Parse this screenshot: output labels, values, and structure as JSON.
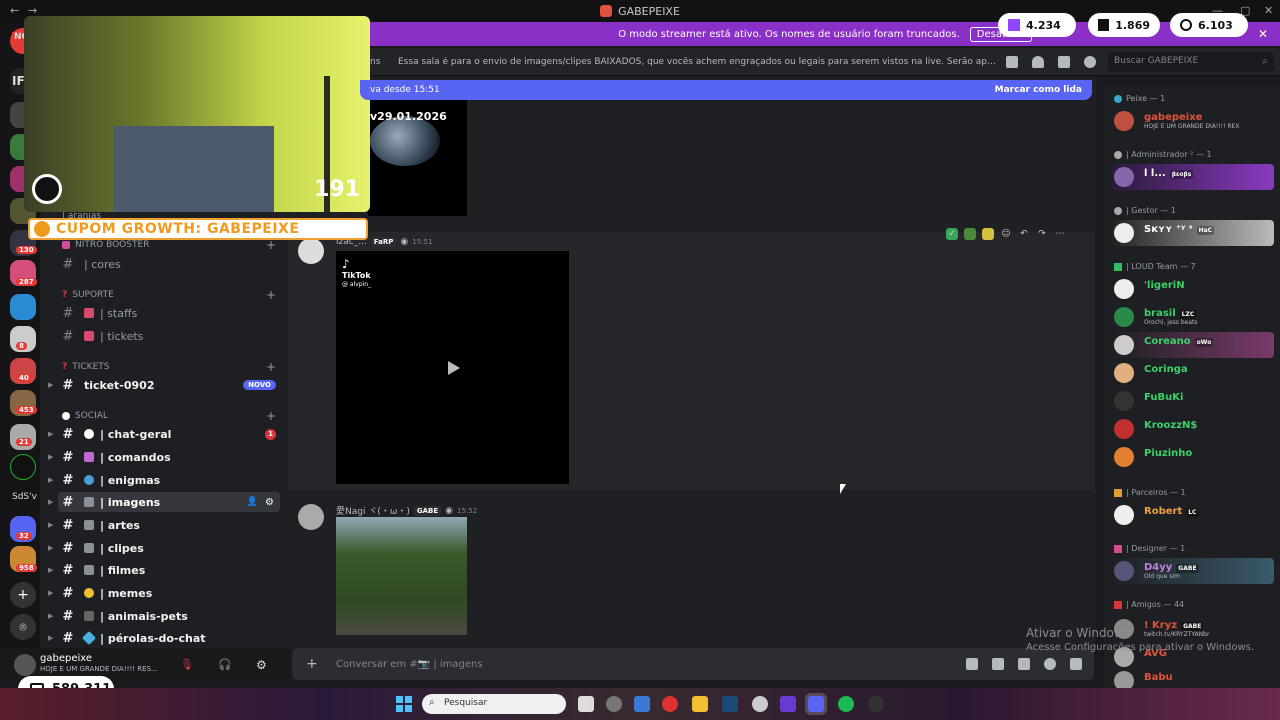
{
  "window": {
    "title": "GABEPEIXE"
  },
  "streamer_banner": {
    "text": "O modo streamer está ativo. Os nomes de usuário foram truncados.",
    "button": "Desativar"
  },
  "stats": [
    {
      "icon": "twitch-icon",
      "value": "4.234"
    },
    {
      "icon": "kick-icon",
      "value": "1.869"
    },
    {
      "icon": "globe-icon",
      "value": "6.103"
    }
  ],
  "channel_header": {
    "name_fragment": "ns",
    "topic": "Essa sala é para o envio de imagens/clipes BAIXADOS, que vocês achem engraçados ou legais para serem vistos na live. Serão apagados prints de o..."
  },
  "search": {
    "placeholder": "Buscar GABEPEIXE"
  },
  "new_messages_bar": {
    "left": "va desde 15:51",
    "right": "Marcar como lida"
  },
  "webcam": {
    "counter": "191"
  },
  "promo": {
    "text": "CUPOM GROWTH: GABEPEIXE"
  },
  "rail": {
    "labels": [
      "NO",
      "IF",
      "SdS'v"
    ],
    "badges": [
      "130",
      "287",
      "8",
      "40",
      "453",
      "21",
      "32",
      "958"
    ]
  },
  "channel_list": {
    "partial_top": "| aranias",
    "categories": {
      "nitro": "NITRO BOOSTER",
      "suporte": "SUPORTE",
      "tickets": "TICKETS",
      "social": "SOCIAL"
    },
    "channels": {
      "cores": "| cores",
      "staffs": "| staffs",
      "tickets": "| tickets",
      "ticket_0902": "ticket-0902",
      "chat_geral": "| chat-geral",
      "comandos": "| comandos",
      "enigmas": "| enigmas",
      "imagens": "| imagens",
      "artes": "| artes",
      "clipes": "| clipes",
      "filmes": "| filmes",
      "memes": "| memes",
      "animais_pets": "| animais-pets",
      "perolas": "| pérolas-do-chat"
    },
    "badge_new": "NOVO",
    "badge_unread": "1"
  },
  "messages": {
    "m1": {
      "user": "lzac_...",
      "tag": "FaRP",
      "time": "15:51",
      "attachment_logo": "TikTok",
      "attachment_handle": "@ alvpin_"
    },
    "m2": {
      "user": "愛Nagi ヾ(・ω・)",
      "tag": "GABE",
      "time": "15:52"
    },
    "top_image_text": "v29.01.2026"
  },
  "composer": {
    "placeholder": "Conversar em #📷 | imagens"
  },
  "user_panel": {
    "name": "gabepeixe",
    "status": "HOJE E UM GRANDE DIA!!!! RES...",
    "coins": "589.311"
  },
  "members": {
    "roles": {
      "peixe": "Peixe — 1",
      "admin": "| Administrador ² — 1",
      "gestor": "| Gestor — 1",
      "loud": "| LOUD Team — 7",
      "parceiros": "| Parceiros — 1",
      "designer": "| Designer — 1",
      "amigos": "| Amigos — 44"
    },
    "list": {
      "gabepeixe": {
        "name": "gabepeixe",
        "sub": "HOJE E UM GRANDE DIA!!!! REX"
      },
      "admin1": {
        "name": "l l...",
        "tag": "βεοβs"
      },
      "skyy": {
        "name": "Sĸʏʏ ⁺ʸ ˢ",
        "tag": "HaC"
      },
      "ligerin": {
        "name": "'ligeriN"
      },
      "brasil": {
        "name": "brasil",
        "tag": "LZC",
        "sub": "Orochi, jess beats"
      },
      "coreano": {
        "name": "Coreano",
        "tag": "oWo"
      },
      "coringa": {
        "name": "Coringa"
      },
      "fubuki": {
        "name": "FuBuKi"
      },
      "kroozz": {
        "name": "KroozzN$"
      },
      "piuzinho": {
        "name": "Piuzinho"
      },
      "robert": {
        "name": "Robert",
        "tag": "LC"
      },
      "d4yy": {
        "name": "D4yy",
        "tag": "GABE",
        "sub": "Old que sim"
      },
      "kryz": {
        "name": "! Kryz",
        "tag": "GABE",
        "sub": "twitch.tv/KRYZTYANbr"
      },
      "avg": {
        "name": "AVG"
      },
      "babu": {
        "name": "Babu"
      }
    }
  },
  "watermark": {
    "line1": "Ativar o Windows",
    "line2": "Acesse Configurações para ativar o Windows."
  },
  "taskbar": {
    "search_placeholder": "Pesquisar"
  }
}
